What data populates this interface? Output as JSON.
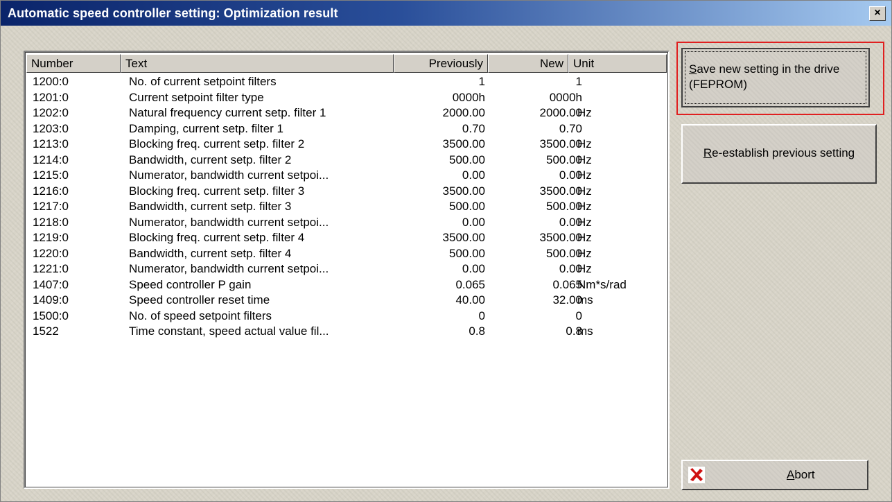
{
  "window": {
    "title": "Automatic speed controller setting: Optimization result",
    "close_label": "×"
  },
  "table": {
    "columns": [
      "Number",
      "Text",
      "Previously",
      "New",
      "Unit"
    ],
    "rows": [
      [
        "1200:0",
        "No. of current setpoint filters",
        "1",
        "1",
        ""
      ],
      [
        "1201:0",
        "Current setpoint filter type",
        "0000h",
        "0000h",
        ""
      ],
      [
        "1202:0",
        "Natural frequency current setp. filter 1",
        "2000.00",
        "2000.00",
        "Hz"
      ],
      [
        "1203:0",
        "Damping, current setp. filter 1",
        "0.70",
        "0.70",
        ""
      ],
      [
        "1213:0",
        "Blocking freq. current setp. filter 2",
        "3500.00",
        "3500.00",
        "Hz"
      ],
      [
        "1214:0",
        "Bandwidth, current setp. filter 2",
        "500.00",
        "500.00",
        "Hz"
      ],
      [
        "1215:0",
        "Numerator, bandwidth current setpoi...",
        "0.00",
        "0.00",
        "Hz"
      ],
      [
        "1216:0",
        "Blocking freq. current setp. filter 3",
        "3500.00",
        "3500.00",
        "Hz"
      ],
      [
        "1217:0",
        "Bandwidth, current setp. filter 3",
        "500.00",
        "500.00",
        "Hz"
      ],
      [
        "1218:0",
        "Numerator, bandwidth current setpoi...",
        "0.00",
        "0.00",
        "Hz"
      ],
      [
        "1219:0",
        "Blocking freq. current setp. filter 4",
        "3500.00",
        "3500.00",
        "Hz"
      ],
      [
        "1220:0",
        "Bandwidth, current setp. filter 4",
        "500.00",
        "500.00",
        "Hz"
      ],
      [
        "1221:0",
        "Numerator, bandwidth current setpoi...",
        "0.00",
        "0.00",
        "Hz"
      ],
      [
        "1407:0",
        "Speed controller P gain",
        "0.065",
        "0.065",
        "Nm*s/rad"
      ],
      [
        "1409:0",
        "Speed controller reset time",
        "40.00",
        "32.00",
        "ms"
      ],
      [
        "1500:0",
        "No. of speed setpoint filters",
        "0",
        "0",
        ""
      ],
      [
        "1522",
        "Time constant, speed actual value fil...",
        "0.8",
        "0.8",
        "ms"
      ]
    ]
  },
  "buttons": {
    "save_line1_key": "S",
    "save_line1_rest": "ave new setting in the drive",
    "save_line2": "(FEPROM)",
    "reestablish_key": "R",
    "reestablish_rest": "e-establish previous setting",
    "abort_key": "A",
    "abort_rest": "bort"
  },
  "colors": {
    "title_gradient_start": "#0a246a",
    "title_gradient_end": "#a6caf0",
    "highlight_border": "#e02020",
    "abort_icon": "#d01010"
  },
  "icons": {
    "abort": "red-x-icon",
    "close": "close-icon"
  }
}
